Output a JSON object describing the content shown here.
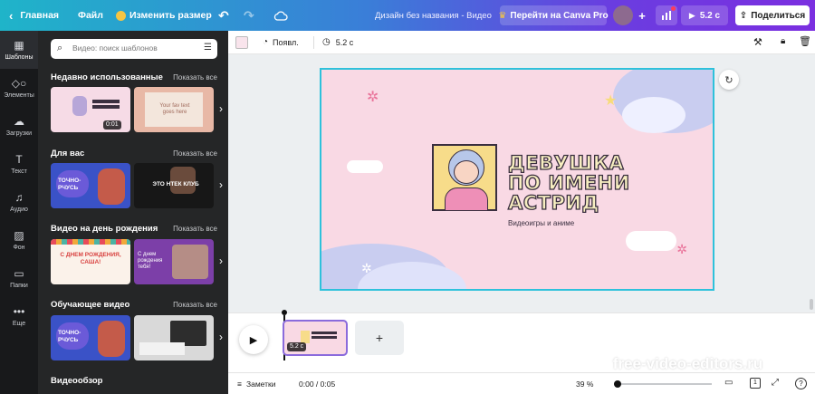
{
  "topbar": {
    "home_label": "Главная",
    "file_label": "Файл",
    "resize_label": "Изменить размер",
    "design_title": "Дизайн без названия - Видео",
    "upgrade_label": "Перейти на Canva Pro",
    "present_label": "5.2 с",
    "share_label": "Поделиться"
  },
  "rail": {
    "items": [
      {
        "label": "Шаблоны",
        "icon": "templates-icon"
      },
      {
        "label": "Элементы",
        "icon": "elements-icon"
      },
      {
        "label": "Загрузки",
        "icon": "uploads-icon"
      },
      {
        "label": "Текст",
        "icon": "text-icon"
      },
      {
        "label": "Аудио",
        "icon": "audio-icon"
      },
      {
        "label": "Фон",
        "icon": "background-icon"
      },
      {
        "label": "Папки",
        "icon": "folders-icon"
      },
      {
        "label": "Еще",
        "icon": "more-icon"
      }
    ]
  },
  "panel": {
    "search_placeholder": "Видео: поиск шаблонов",
    "show_all": "Показать все",
    "sections": [
      {
        "title": "Недавно использованные",
        "thumbs": [
          {
            "badge": "0:01",
            "text": ""
          },
          {
            "badge": "",
            "text": "Your fav text goes here"
          }
        ]
      },
      {
        "title": "Для вас",
        "thumbs": [
          {
            "badge": "",
            "text": "ТОЧНО-РЧУСЬ"
          },
          {
            "badge": "",
            "text": "ЭТО НТЕК КЛУБ"
          }
        ]
      },
      {
        "title": "Видео на день рождения",
        "thumbs": [
          {
            "badge": "",
            "text": "С ДНЕМ РОЖДЕНИЯ, САША!"
          },
          {
            "badge": "",
            "text": "С днем рождения тебя!"
          }
        ]
      },
      {
        "title": "Обучающее видео",
        "thumbs": [
          {
            "badge": "",
            "text": "ТОЧНО-РЧУСЬ"
          },
          {
            "badge": "",
            "text": ""
          }
        ]
      },
      {
        "title": "Видеообзор",
        "thumbs": []
      }
    ]
  },
  "toolbar": {
    "animate_label": "Появл.",
    "duration_label": "5.2 с"
  },
  "canvas": {
    "headline_lines": [
      "ДЕВУШКА",
      "ПО ИМЕНИ",
      "АСТРИД"
    ],
    "subtitle": "Видеоигры и аниме",
    "bg_color": "#f9d9e4"
  },
  "timeline": {
    "page_duration": "5.2 с"
  },
  "bottombar": {
    "notes_label": "Заметки",
    "time_label": "0:00 / 0:05",
    "zoom_label": "39 %",
    "page_count": "1",
    "help_label": "?",
    "zoom_fraction": 0.39
  },
  "watermark": "free-video-editors.ru",
  "colors": {
    "accent": "#2ec1db",
    "rail_bg": "#18191b",
    "panel_bg": "#252627"
  }
}
